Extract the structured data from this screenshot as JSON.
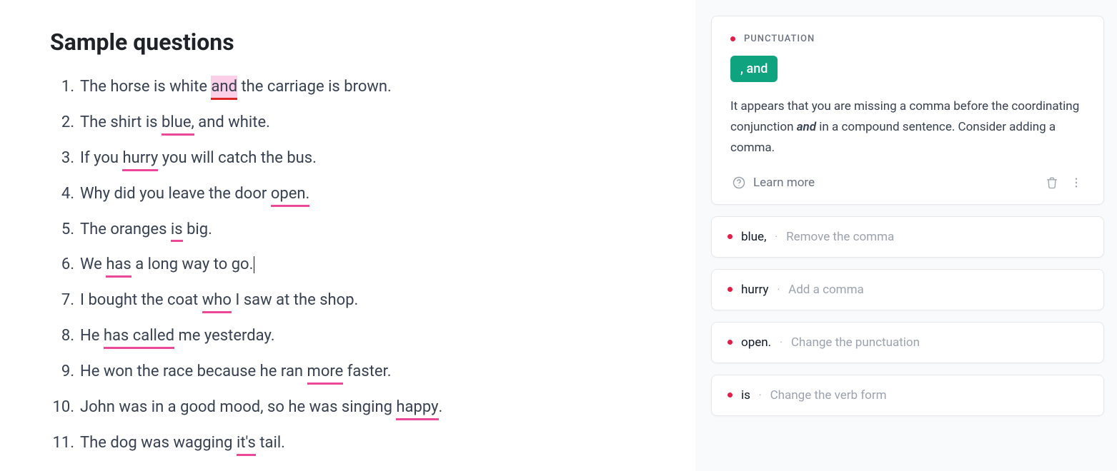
{
  "title": "Sample questions",
  "questions": [
    {
      "parts": [
        {
          "t": "The horse is white "
        },
        {
          "t": "and",
          "err": true,
          "red": true,
          "sel": true
        },
        {
          "t": " the carriage is brown."
        }
      ]
    },
    {
      "parts": [
        {
          "t": "The shirt is "
        },
        {
          "t": "blue,",
          "err": true
        },
        {
          "t": " and white."
        }
      ]
    },
    {
      "parts": [
        {
          "t": "If you "
        },
        {
          "t": "hurry",
          "err": true
        },
        {
          "t": " you will catch the bus."
        }
      ]
    },
    {
      "parts": [
        {
          "t": "Why did you leave the door "
        },
        {
          "t": "open.",
          "err": true
        }
      ]
    },
    {
      "parts": [
        {
          "t": "The oranges "
        },
        {
          "t": "is",
          "err": true
        },
        {
          "t": " big."
        }
      ]
    },
    {
      "parts": [
        {
          "t": "We "
        },
        {
          "t": "has",
          "err": true
        },
        {
          "t": " a long way to go."
        }
      ],
      "cursor": true
    },
    {
      "parts": [
        {
          "t": "I bought the coat "
        },
        {
          "t": "who",
          "err": true
        },
        {
          "t": " I saw at the shop."
        }
      ]
    },
    {
      "parts": [
        {
          "t": "He "
        },
        {
          "t": "has called",
          "err": true
        },
        {
          "t": " me yesterday."
        }
      ]
    },
    {
      "parts": [
        {
          "t": "He won the race because he ran "
        },
        {
          "t": "more",
          "err": true
        },
        {
          "t": " faster."
        }
      ]
    },
    {
      "parts": [
        {
          "t": "John was in a good mood, so he was singing "
        },
        {
          "t": "happy",
          "err": true
        },
        {
          "t": "."
        }
      ]
    },
    {
      "parts": [
        {
          "t": "The dog was wagging "
        },
        {
          "t": "it's",
          "err": true
        },
        {
          "t": " tail."
        }
      ]
    }
  ],
  "expanded": {
    "category": "PUNCTUATION",
    "suggestion": ", and",
    "explanation_pre": "It appears that you are missing a comma before the coordinating conjunction ",
    "explanation_em": "and",
    "explanation_post": " in a compound sentence. Consider adding a comma.",
    "learn_more": "Learn more"
  },
  "collapsed": [
    {
      "word": "blue,",
      "hint": "Remove the comma"
    },
    {
      "word": "hurry",
      "hint": "Add a comma"
    },
    {
      "word": "open.",
      "hint": "Change the punctuation"
    },
    {
      "word": "is",
      "hint": "Change the verb form"
    }
  ]
}
